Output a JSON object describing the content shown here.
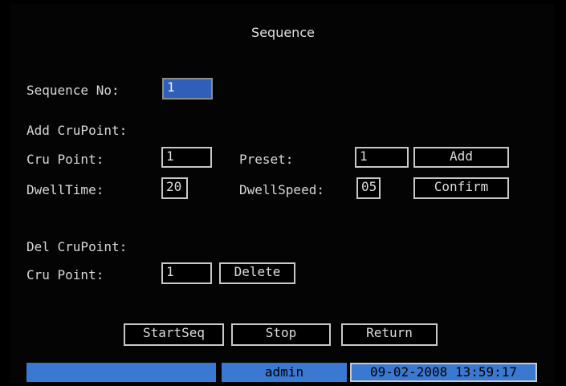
{
  "title": "Sequence",
  "sequence_no": {
    "label": "Sequence No:",
    "value": "1"
  },
  "add_section": {
    "heading": "Add CruPoint:",
    "cru_point": {
      "label": "Cru Point:",
      "value": "1"
    },
    "preset": {
      "label": "Preset:",
      "value": "1"
    },
    "dwell_time": {
      "label": "DwellTime:",
      "value": "20"
    },
    "dwell_speed": {
      "label": "DwellSpeed:",
      "value": "05"
    },
    "add_button": "Add",
    "confirm_button": "Confirm"
  },
  "del_section": {
    "heading": "Del CruPoint:",
    "cru_point": {
      "label": "Cru Point:",
      "value": "1"
    },
    "delete_button": "Delete"
  },
  "footer_buttons": {
    "start": "StartSeq",
    "stop": "Stop",
    "return": "Return"
  },
  "status_bar": {
    "user": "admin",
    "datetime": "09-02-2008 13:59:17"
  },
  "colors": {
    "background": "#040404",
    "accent_blue": "#3a78d2",
    "text": "#d8d8d8"
  }
}
